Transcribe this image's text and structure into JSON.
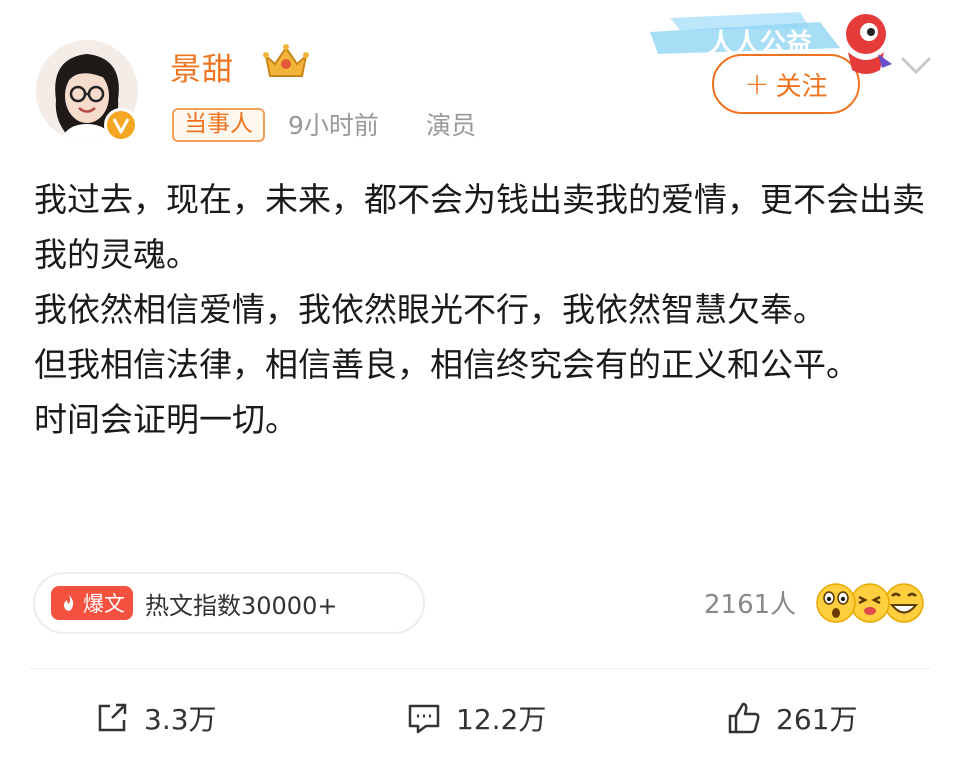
{
  "author": {
    "name": "景甜",
    "tag": "当事人",
    "time": "9小时前",
    "occupation": "演员"
  },
  "banner_text": "人人公益",
  "follow_button": {
    "icon": "plus-icon",
    "label": "关注"
  },
  "post": {
    "paragraphs": [
      "我过去，现在，未来，都不会为钱出卖我的爱情，更不会出卖我的灵魂。",
      "我依然相信爱情，我依然眼光不行，我依然智慧欠奉。",
      "但我相信法律，相信善良，相信终究会有的正义和公平。",
      "时间会证明一切。"
    ]
  },
  "hot_index": {
    "badge": "爆文",
    "text": "热文指数30000+"
  },
  "reactions": {
    "count": "2161人",
    "emoji": [
      "shocked-emoji",
      "kiss-emoji",
      "laugh-emoji"
    ]
  },
  "actions": {
    "repost": {
      "icon": "share-icon",
      "count": "3.3万"
    },
    "comment": {
      "icon": "comment-icon",
      "count": "12.2万"
    },
    "like": {
      "icon": "thumbs-up-icon",
      "count": "261万"
    }
  },
  "colors": {
    "accent": "#f0741f",
    "hot_red": "#f4513f",
    "muted": "#999999"
  }
}
